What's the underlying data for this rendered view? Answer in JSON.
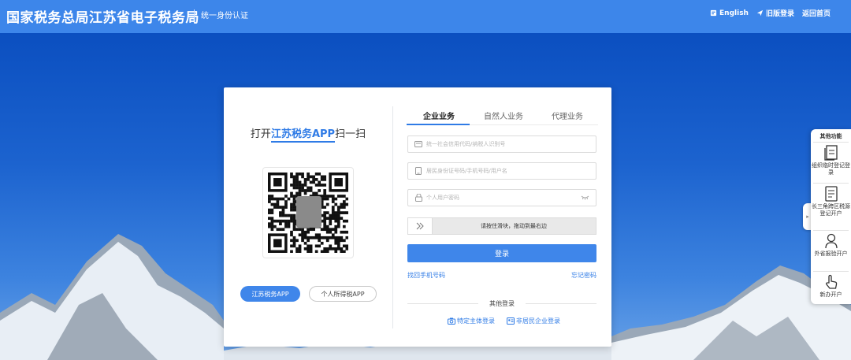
{
  "header": {
    "title": "国家税务总局江苏省电子税务局",
    "subtitle": "统一身份认证",
    "links": [
      {
        "label": "English",
        "icon": "globe-icon"
      },
      {
        "label": "旧版登录",
        "icon": "send-icon"
      },
      {
        "label": "返回首页",
        "icon": ""
      }
    ]
  },
  "qr_panel": {
    "title_prefix": "打开",
    "title_highlight": "江苏税务APP",
    "title_suffix": "扫一扫",
    "app_buttons": [
      "江苏税务APP",
      "个人所得税APP"
    ]
  },
  "login": {
    "tabs": [
      "企业业务",
      "自然人业务",
      "代理业务"
    ],
    "active_tab": "企业业务",
    "fields": {
      "taxpayer_id": {
        "placeholder": "统一社会信用代码/纳税人识别号",
        "value": ""
      },
      "id_or_phone": {
        "placeholder": "居民身份证号码/手机号码/用户名",
        "value": ""
      },
      "password": {
        "placeholder": "个人用户密码",
        "value": ""
      }
    },
    "slider_text": "请按住滑块，拖动到最右边",
    "login_button": "登录",
    "retrieve_phone": "找回手机号码",
    "forgot_password": "忘记密码",
    "other_login_title": "其他登录",
    "alt_logins": [
      "特定主体登录",
      "非居民企业登录"
    ]
  },
  "side_panel": {
    "title": "其他功能",
    "items": [
      {
        "label": "组织临时登记登录",
        "icon": "document-icon"
      },
      {
        "label": "长三角跨区税源登记开户",
        "icon": "document-list-icon"
      },
      {
        "label": "外省报验开户",
        "icon": "person-icon"
      },
      {
        "label": "新办开户",
        "icon": "hand-pointer-icon"
      }
    ]
  },
  "colors": {
    "accent": "#3f86ea",
    "header_bg": "#3d86ea",
    "link": "#2f7be6"
  }
}
